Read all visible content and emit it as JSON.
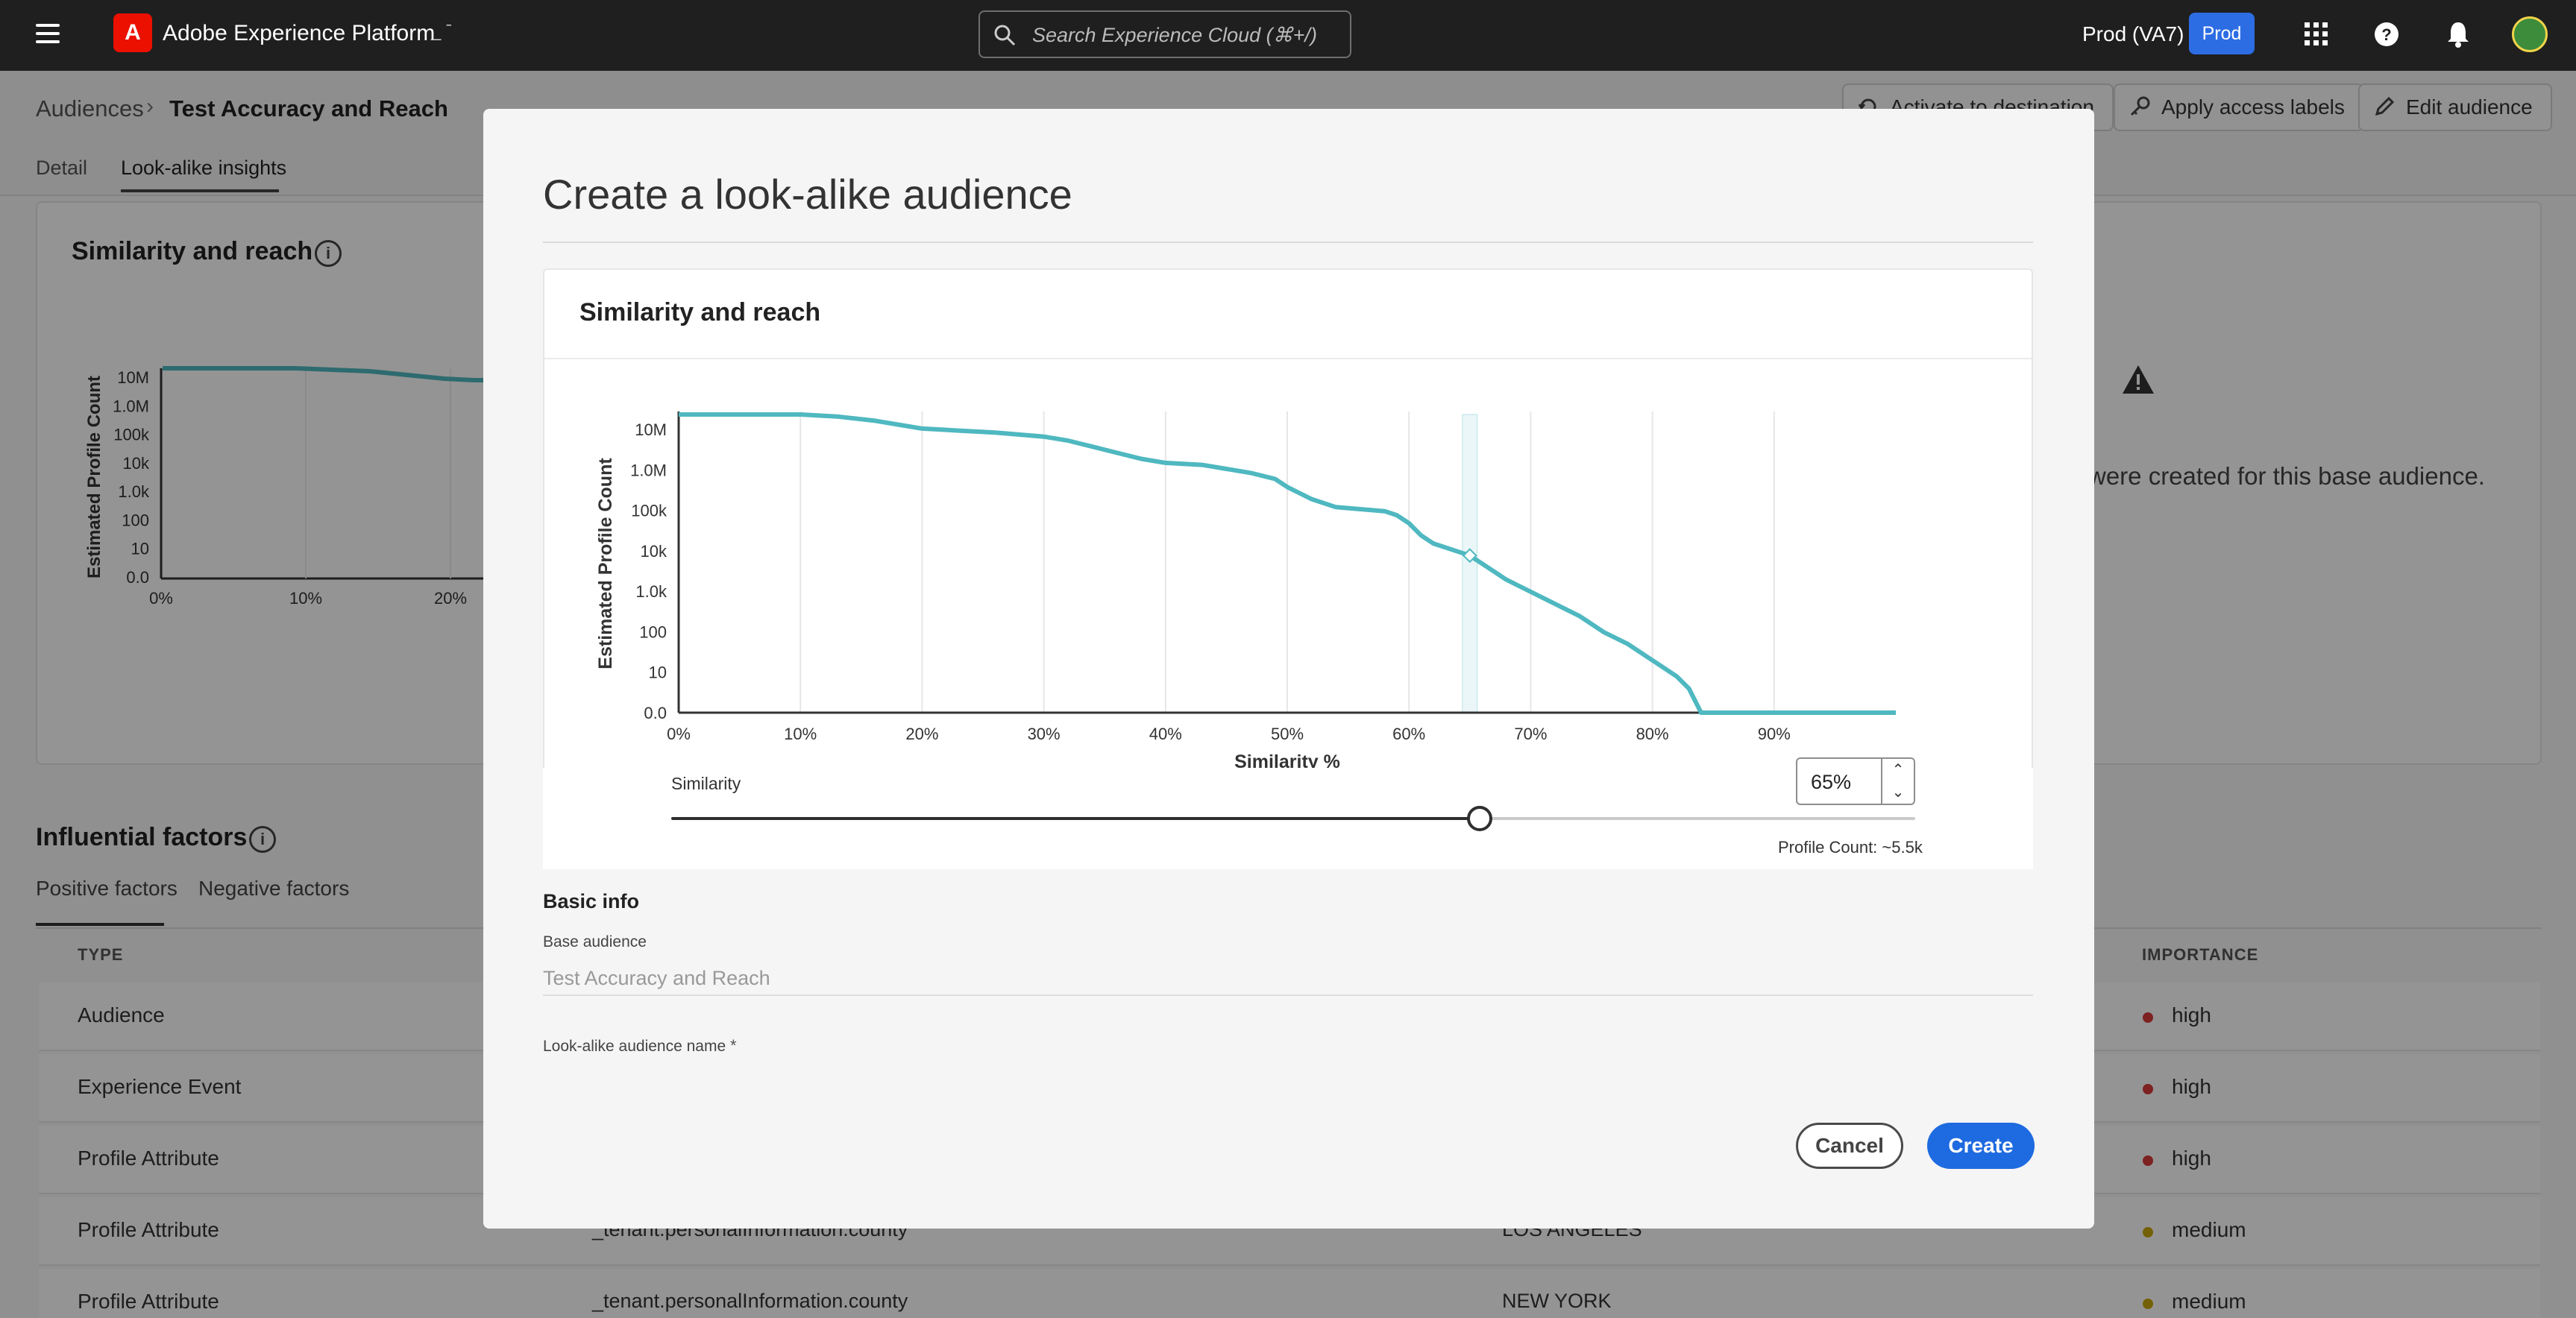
{
  "topbar": {
    "app_title": "Adobe Experience Platform",
    "logo_letter": "A",
    "extra": "_ ˉ",
    "search_placeholder": "Search Experience Cloud (⌘+/)",
    "org": "Prod (VA7)",
    "env_badge": "Prod",
    "icons": [
      "menu-icon",
      "apps-grid-icon",
      "help-icon",
      "bell-icon",
      "avatar"
    ]
  },
  "breadcrumb": {
    "root": "Audiences",
    "separator": "›",
    "current": "Test Accuracy and Reach"
  },
  "header_buttons": {
    "activate": "Activate to destination",
    "access": "Apply access labels",
    "edit": "Edit audience"
  },
  "tabs": [
    "Detail",
    "Look-alike insights"
  ],
  "background_card": {
    "title": "Similarity and reach",
    "info": "i",
    "warning_text": "were created for this base audience.",
    "ylabel": "Estimated Profile Count",
    "y_ticks": [
      "10M",
      "1.0M",
      "100k",
      "10k",
      "1.0k",
      "100",
      "10",
      "0.0"
    ],
    "x_ticks": [
      "0%",
      "10%",
      "20%"
    ]
  },
  "influential": {
    "title": "Influential factors",
    "tabs": [
      "Positive factors",
      "Negative factors"
    ],
    "columns": [
      "TYPE",
      "IMPORTANCE"
    ],
    "rows": [
      {
        "type": "Audience",
        "attr": "",
        "value": "",
        "importance": "high",
        "color": "#d73a3a"
      },
      {
        "type": "Experience Event",
        "attr": "",
        "value": "",
        "importance": "high",
        "color": "#d73a3a"
      },
      {
        "type": "Profile Attribute",
        "attr": "",
        "value": "",
        "importance": "high",
        "color": "#d73a3a"
      },
      {
        "type": "Profile Attribute",
        "attr": "_tenant.personalInformation.county",
        "value": "LOS ANGELES",
        "importance": "medium",
        "color": "#c9a80a"
      },
      {
        "type": "Profile Attribute",
        "attr": "_tenant.personalInformation.county",
        "value": "NEW YORK",
        "importance": "medium",
        "color": "#c9a80a"
      }
    ]
  },
  "modal": {
    "title": "Create a look-alike audience",
    "card_title": "Similarity and reach",
    "similarity_label": "Similarity",
    "similarity_value": "65%",
    "slider_value_percent": 65,
    "profile_count": "Profile Count: ~5.5k",
    "basic_info": "Basic info",
    "base_audience_label": "Base audience",
    "base_audience_value": "Test Accuracy and Reach",
    "name_label": "Look-alike audience name",
    "required_mark": "*",
    "cancel": "Cancel",
    "create": "Create"
  },
  "chart_data": {
    "type": "line",
    "xlabel": "Similarity %",
    "ylabel": "Estimated Profile Count",
    "x_ticks": [
      "0%",
      "10%",
      "20%",
      "30%",
      "40%",
      "50%",
      "60%",
      "70%",
      "80%",
      "90%"
    ],
    "y_ticks": [
      "10M",
      "1.0M",
      "100k",
      "10k",
      "1.0k",
      "100",
      "10",
      "0.0"
    ],
    "y_scale": "log",
    "xlim": [
      0,
      100
    ],
    "highlight_x": 65,
    "series_color": "#4fb8c0",
    "x": [
      0,
      5,
      10,
      13,
      16,
      18,
      20,
      23,
      26,
      30,
      32,
      34,
      36,
      38,
      40,
      43,
      45,
      47,
      49,
      50,
      52,
      54,
      56,
      58,
      59,
      60,
      61,
      62,
      64,
      65,
      66,
      67,
      68,
      70,
      72,
      74,
      76,
      78,
      80,
      81,
      82,
      83,
      84,
      85,
      88,
      90,
      95,
      100
    ],
    "y_level": [
      7.4,
      7.4,
      7.4,
      7.35,
      7.25,
      7.15,
      7.05,
      7.0,
      6.95,
      6.85,
      6.75,
      6.6,
      6.45,
      6.3,
      6.2,
      6.15,
      6.05,
      5.95,
      5.8,
      5.6,
      5.3,
      5.1,
      5.05,
      5.0,
      4.9,
      4.7,
      4.4,
      4.2,
      4.0,
      3.9,
      3.7,
      3.5,
      3.3,
      3.0,
      2.7,
      2.4,
      2.0,
      1.7,
      1.3,
      1.1,
      0.9,
      0.6,
      0.0,
      0.0,
      0.0,
      0.0,
      0.0,
      0.0
    ]
  }
}
